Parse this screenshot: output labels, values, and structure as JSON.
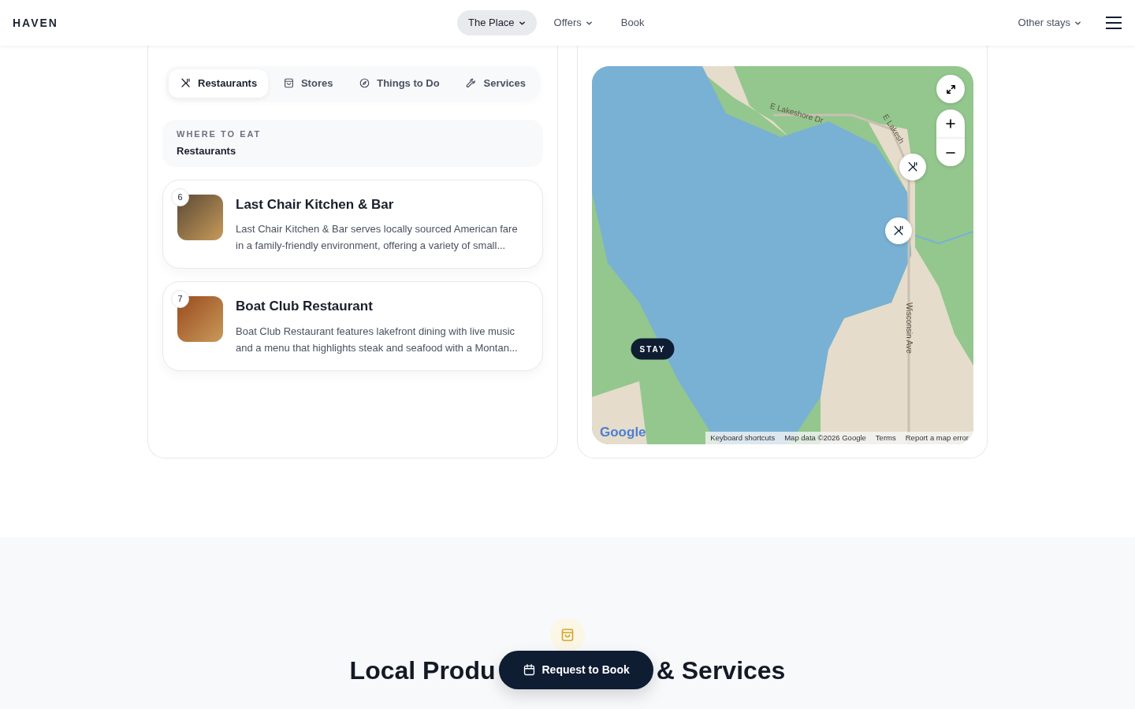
{
  "navbar": {
    "brand": "HAVEN",
    "links": [
      {
        "label": "The Place",
        "dropdown": true,
        "selected": true
      },
      {
        "label": "Offers",
        "dropdown": true,
        "selected": false
      },
      {
        "label": "Book",
        "dropdown": false,
        "selected": false
      }
    ],
    "other": {
      "label": "Other stays",
      "dropdown": true
    }
  },
  "favorites": {
    "tabs": [
      {
        "label": "Restaurants",
        "kind": "utensils",
        "selected": true
      },
      {
        "label": "Stores",
        "kind": "bag",
        "selected": false
      },
      {
        "label": "Things to Do",
        "kind": "compass",
        "selected": false
      },
      {
        "label": "Services",
        "kind": "wrench",
        "selected": false
      }
    ],
    "section": {
      "eyebrow": "WHERE TO EAT",
      "title": "Restaurants"
    },
    "places": [
      {
        "number": "6",
        "name": "Last Chair Kitchen & Bar",
        "description": "Last Chair Kitchen & Bar serves locally sourced American fare in a family-friendly environment, offering a variety of small..."
      },
      {
        "number": "7",
        "name": "Boat Club Restaurant",
        "description": "Boat Club Restaurant features lakefront dining with live music and a menu that highlights steak and seafood with a Montan..."
      }
    ]
  },
  "map": {
    "road_labels": [
      {
        "label": "E Lakeshore Dr",
        "kind": "lakeshore"
      },
      {
        "label": "E Lakesh",
        "kind": "lakeshore-east"
      },
      {
        "label": "Wisconsin Ave",
        "kind": "avenue"
      }
    ],
    "markers": [
      {
        "kind": "restaurant"
      },
      {
        "kind": "restaurant"
      },
      {
        "kind": "stay",
        "label": "STAY"
      }
    ],
    "logo": "Google",
    "attribution": [
      "Keyboard shortcuts",
      "Map data ©2026 Google",
      "Terms",
      "Report a map error"
    ]
  },
  "cta": {
    "heading_start": "Local Produ",
    "heading_end": "& Services",
    "button": "Request to Book"
  }
}
